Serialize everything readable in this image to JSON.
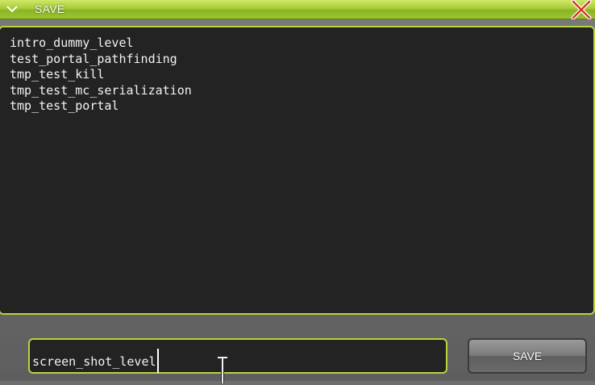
{
  "window": {
    "title": "SAVE",
    "collapse_icon": "chevron-down-icon",
    "close_icon": "close-icon",
    "accent_color": "#b8d43e"
  },
  "file_list": {
    "items": [
      "intro_dummy_level",
      "test_portal_pathfinding",
      "tmp_test_kill",
      "tmp_test_mc_serialization",
      "tmp_test_portal"
    ]
  },
  "name_input": {
    "value": "screen_shot_level"
  },
  "actions": {
    "save_label": "SAVE"
  }
}
